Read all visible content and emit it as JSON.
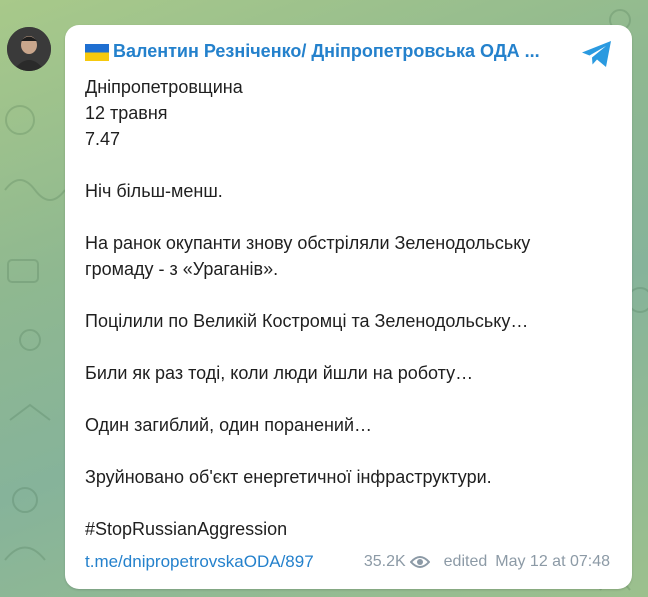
{
  "channel": {
    "title": "Валентин Резніченко/ Дніпропетровська ОДА ...",
    "flag_icon": "ukraine-flag-icon",
    "avatar_icon": "avatar",
    "share_icon": "telegram-icon",
    "accent_color": "#2481cc"
  },
  "post": {
    "lines": [
      "Дніпропетровщина",
      "12 травня",
      "7.47",
      "Ніч більш-менш.",
      "На ранок окупанти знову обстріляли Зеленодольську",
      "громаду - з «Ураганів».",
      "Поцілили по Великій Костромці та Зеленодольську…",
      "Били як раз тоді, коли люди йшли на роботу…",
      "Один загиблий, один поранений…",
      "Зруйновано об'єкт енергетичної інфраструктури.",
      "#StopRussianAggression"
    ]
  },
  "footer": {
    "link": "t.me/dnipropetrovskaODA/897",
    "views": "35.2K",
    "views_icon": "eye-icon",
    "edited_label": "edited",
    "timestamp": "May 12 at 07:48"
  }
}
